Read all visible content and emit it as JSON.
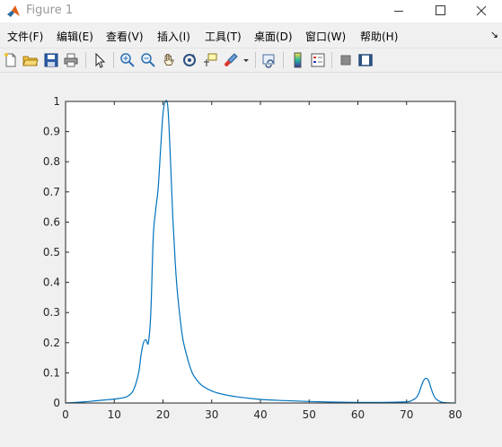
{
  "window": {
    "title": "Figure 1"
  },
  "menu": [
    {
      "label": "文件(F)"
    },
    {
      "label": "编辑(E)"
    },
    {
      "label": "查看(V)"
    },
    {
      "label": "插入(I)"
    },
    {
      "label": "工具(T)"
    },
    {
      "label": "桌面(D)"
    },
    {
      "label": "窗口(W)"
    },
    {
      "label": "帮助(H)"
    }
  ],
  "colors": {
    "line": "#0072bd",
    "axes_bg": "#ffffff",
    "figure_bg": "#f0f0f0"
  },
  "chart_data": {
    "type": "line",
    "xlim": [
      0,
      80
    ],
    "ylim": [
      0,
      1
    ],
    "x_ticks": [
      0,
      10,
      20,
      30,
      40,
      50,
      60,
      70,
      80
    ],
    "y_ticks": [
      0,
      0.1,
      0.2,
      0.3,
      0.4,
      0.5,
      0.6,
      0.7,
      0.8,
      0.9,
      1
    ],
    "x_tick_labels": [
      "0",
      "10",
      "20",
      "30",
      "40",
      "50",
      "60",
      "70",
      "80"
    ],
    "y_tick_labels": [
      "0",
      "0.1",
      "0.2",
      "0.3",
      "0.4",
      "0.5",
      "0.6",
      "0.7",
      "0.8",
      "0.9",
      "1"
    ],
    "grid": false,
    "series": [
      {
        "x": [
          0,
          2,
          4,
          6,
          8,
          10,
          12,
          13,
          14,
          15,
          15.5,
          16,
          16.5,
          17,
          17.5,
          18,
          18.5,
          19,
          19.5,
          20,
          20.5,
          21,
          21.5,
          22,
          22.5,
          23,
          24,
          25,
          26,
          27,
          28,
          30,
          32,
          35,
          40,
          45,
          50,
          55,
          60,
          65,
          70,
          71,
          72,
          72.5,
          73,
          73.5,
          74,
          74.5,
          75,
          75.5,
          76,
          77,
          78,
          80
        ],
        "y": [
          0,
          0.002,
          0.004,
          0.007,
          0.01,
          0.013,
          0.018,
          0.025,
          0.045,
          0.1,
          0.16,
          0.2,
          0.21,
          0.2,
          0.3,
          0.55,
          0.64,
          0.71,
          0.84,
          0.96,
          1.0,
          0.98,
          0.82,
          0.62,
          0.47,
          0.36,
          0.22,
          0.15,
          0.1,
          0.075,
          0.058,
          0.04,
          0.03,
          0.021,
          0.012,
          0.008,
          0.005,
          0.003,
          0.002,
          0.002,
          0.004,
          0.008,
          0.018,
          0.032,
          0.055,
          0.075,
          0.082,
          0.075,
          0.05,
          0.028,
          0.014,
          0.004,
          0.001,
          0
        ]
      }
    ]
  }
}
